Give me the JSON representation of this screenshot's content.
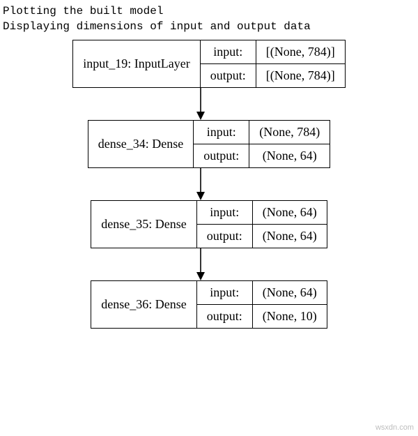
{
  "caption_line1": "Plotting the built model",
  "caption_line2": "Displaying dimensions of input and output data",
  "io_label_input": "input:",
  "io_label_output": "output:",
  "layers": [
    {
      "name": "input_19: InputLayer",
      "input": "[(None, 784)]",
      "output": "[(None, 784)]"
    },
    {
      "name": "dense_34: Dense",
      "input": "(None, 784)",
      "output": "(None, 64)"
    },
    {
      "name": "dense_35: Dense",
      "input": "(None, 64)",
      "output": "(None, 64)"
    },
    {
      "name": "dense_36: Dense",
      "input": "(None, 64)",
      "output": "(None, 10)"
    }
  ],
  "watermark": "wsxdn.com"
}
